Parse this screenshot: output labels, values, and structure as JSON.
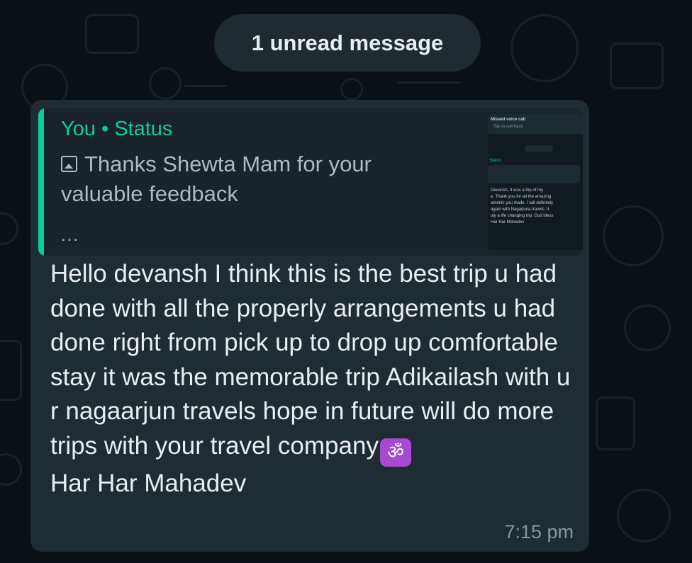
{
  "unread_banner": {
    "label": "1 unread message"
  },
  "quoted_reply": {
    "author": "You",
    "separator": "•",
    "context": "Status",
    "media_icon": "image-icon",
    "caption": "Thanks Shewta Mam for your valuable feedback",
    "more": "...",
    "thumbnail": {
      "missed_call_title": "Missed voice call",
      "missed_call_sub": "Tap to call back",
      "status_label": "Status",
      "feedback_lines": [
        "Devansh, It was a trip of my",
        "e. Thank you for all the amazing",
        "aments you made. I will definitely",
        "again with Nagarjuna travels. It",
        "uly a life changing trip. God bless",
        "Har Har Mahadev"
      ]
    }
  },
  "message": {
    "text": "Hello devansh I think this is the best trip u had done with all the properly arrangements u had done right from pick up to drop up comfortable stay it was the memorable trip Adikailash with u r nagaarjun travels hope in future will do more trips with your travel company",
    "emoji": "ॐ",
    "closing": "Har Har Mahadev",
    "time": "7:15 pm"
  },
  "colors": {
    "background": "#0b1014",
    "bubble": "#202c33",
    "quote_accent": "#06cf9c",
    "text": "#e9edef",
    "muted_text": "#8696a0"
  }
}
